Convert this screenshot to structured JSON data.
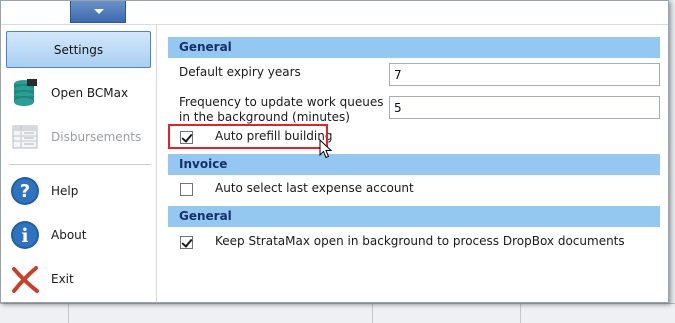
{
  "toolbar": {
    "menu_icon": "chevron-down-icon"
  },
  "sidebar": {
    "settings_label": "Settings",
    "items": [
      {
        "label": "Open BCMax",
        "icon": "database-icon",
        "disabled": false
      },
      {
        "label": "Disbursements",
        "icon": "table-icon",
        "disabled": true
      },
      {
        "label": "Help",
        "icon": "help-icon",
        "disabled": false
      },
      {
        "label": "About",
        "icon": "info-icon",
        "disabled": false
      },
      {
        "label": "Exit",
        "icon": "close-icon",
        "disabled": false
      }
    ]
  },
  "sections": [
    {
      "title": "General",
      "fields": [
        {
          "label": "Default expiry years",
          "value": "7"
        },
        {
          "label": "Frequency to update work queues\nin the background (minutes)",
          "value": "5"
        }
      ],
      "checks": [
        {
          "label": "Auto prefill building",
          "checked": true,
          "highlighted": true
        }
      ]
    },
    {
      "title": "Invoice",
      "checks": [
        {
          "label": "Auto select last expense account",
          "checked": false
        }
      ]
    },
    {
      "title": "General",
      "checks": [
        {
          "label": "Keep StrataMax open in background to process DropBox documents",
          "checked": true
        }
      ]
    }
  ],
  "colors": {
    "section_header_bg": "#94c8f0",
    "section_header_text": "#17306b",
    "selected_nav_bg": "#a9cff3",
    "highlight_border": "#e0242a",
    "help_icon": "#1f5fa8",
    "exit_icon": "#c9402a"
  }
}
